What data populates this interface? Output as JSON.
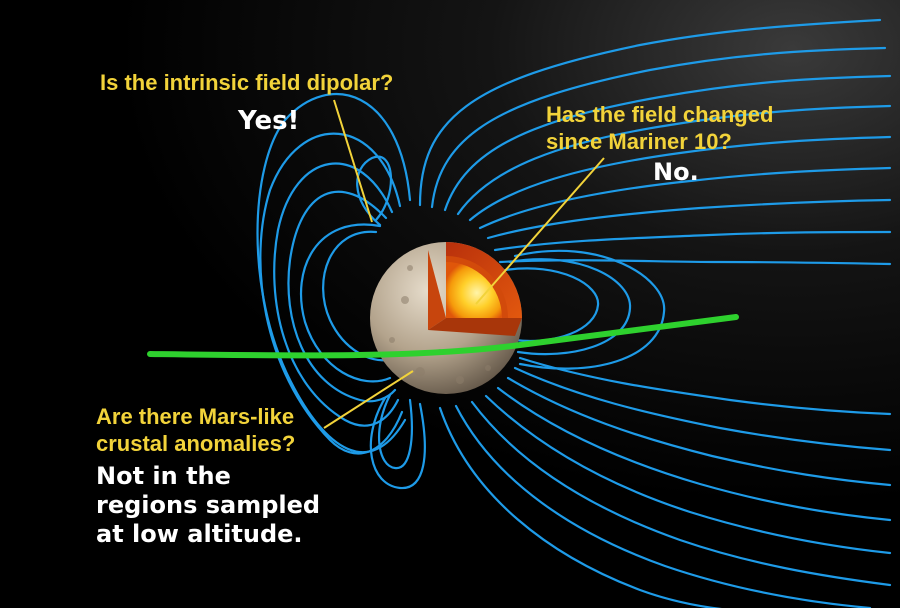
{
  "questions": {
    "dipolar": {
      "question": "Is the intrinsic field dipolar?",
      "answer": "Yes!"
    },
    "changed": {
      "question_line1": "Has the field changed",
      "question_line2": "since Mariner 10?",
      "answer": "No."
    },
    "crustal": {
      "question_line1": "Are there Mars-like",
      "question_line2": "crustal anomalies?",
      "answer_line1": "Not in the",
      "answer_line2": "regions sampled",
      "answer_line3": "at low altitude."
    }
  },
  "colors": {
    "background": "#000000",
    "field_lines": "#1e9be8",
    "trajectory": "#2ed12e",
    "question_text": "#f2d33a",
    "answer_text": "#ffffff",
    "planet_surface": "#a89984",
    "core_outer": "#c2410c",
    "core_inner": "#ffe066"
  }
}
